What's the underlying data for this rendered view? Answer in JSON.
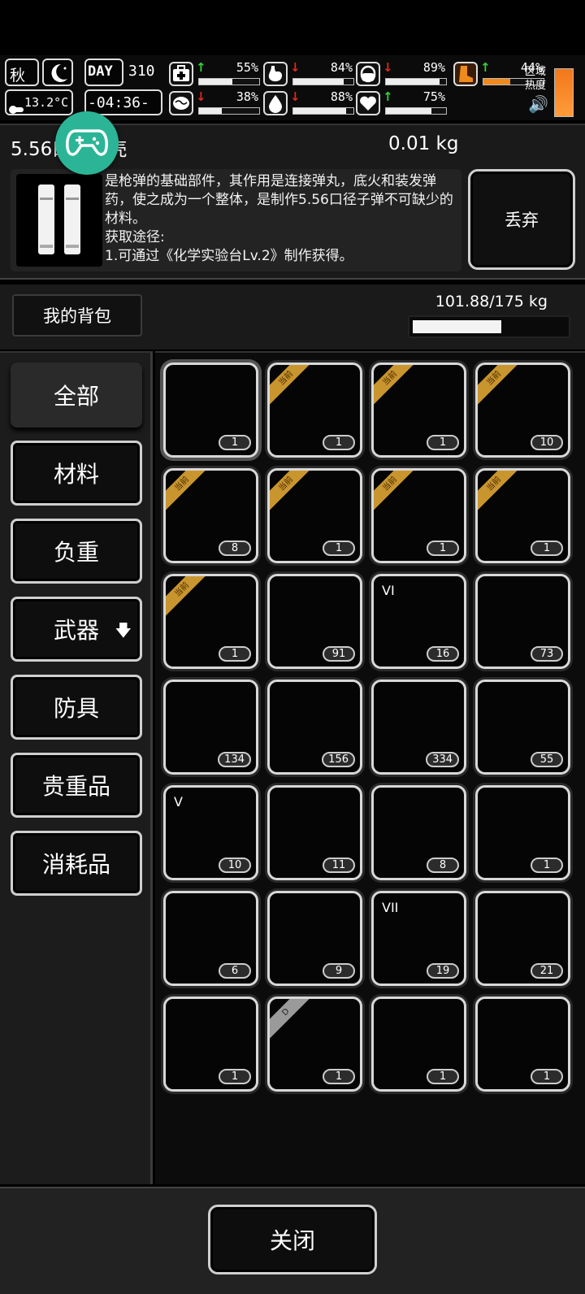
{
  "hud": {
    "season": "秋",
    "temperature": "13.2°C",
    "day_label": "DAY",
    "day_number": "310",
    "time": "-04:36-",
    "zone_label": "区域热度",
    "stats": [
      {
        "name": "health",
        "icon": "medkit-icon",
        "trend": "up",
        "arrow": "↑",
        "value": "55%",
        "level": 0.55
      },
      {
        "name": "hunger",
        "icon": "stomach-icon",
        "trend": "down",
        "arrow": "↓",
        "value": "84%",
        "level": 0.84
      },
      {
        "name": "medicine",
        "icon": "pill-icon",
        "trend": "down",
        "arrow": "↓",
        "value": "89%",
        "level": 0.89
      },
      {
        "name": "brain",
        "icon": "brain-icon",
        "trend": "down",
        "arrow": "↓",
        "value": "38%",
        "level": 0.38
      },
      {
        "name": "thirst",
        "icon": "water-drop-icon",
        "trend": "down",
        "arrow": "↓",
        "value": "88%",
        "level": 0.88
      },
      {
        "name": "mood",
        "icon": "heart-icon",
        "trend": "up",
        "arrow": "↑",
        "value": "75%",
        "level": 0.75
      },
      {
        "name": "stamina",
        "icon": "boot-icon",
        "trend": "up",
        "arrow": "↑",
        "value": "44%",
        "level": 0.44
      }
    ]
  },
  "detail": {
    "name": "5.56口径弹壳",
    "weight": "0.01 kg",
    "description": "是枪弹的基础部件，其作用是连接弹丸，底火和装发弹药，使之成为一个整体，是制作5.56口径子弹不可缺少的材料。",
    "source_label": "获取途径:",
    "source_1": "1.可通过《化学实验台Lv.2》制作获得。",
    "discard_label": "丢弃"
  },
  "backpack": {
    "title": "我的背包",
    "weight_text": "101.88/175 kg",
    "weight_fraction": 0.582
  },
  "categories": [
    {
      "label": "全部",
      "name": "category-all"
    },
    {
      "label": "材料",
      "name": "category-materials"
    },
    {
      "label": "负重",
      "name": "category-load"
    },
    {
      "label": "武器",
      "name": "category-weapons",
      "dl": "🡇"
    },
    {
      "label": "防具",
      "name": "category-armor"
    },
    {
      "label": "贵重品",
      "name": "category-valuables"
    },
    {
      "label": "消耗品",
      "name": "category-consumables"
    }
  ],
  "items": [
    {
      "icon": "bullet-casing",
      "count": "1",
      "tag": ""
    },
    {
      "icon": "exoskeleton",
      "count": "1",
      "tag": "当前"
    },
    {
      "icon": "armor-plate",
      "count": "1",
      "tag": "当前"
    },
    {
      "icon": "ammo-box",
      "count": "10",
      "tag": "当前"
    },
    {
      "icon": "canteen",
      "count": "8",
      "tag": "当前"
    },
    {
      "icon": "gas-mask",
      "count": "1",
      "tag": "当前"
    },
    {
      "icon": "chest-rig",
      "count": "1",
      "tag": "当前"
    },
    {
      "icon": "helmet",
      "count": "1",
      "tag": "当前"
    },
    {
      "icon": "spiked-club",
      "count": "1",
      "tag": "当前"
    },
    {
      "icon": "ore-rock",
      "count": "91",
      "tag": ""
    },
    {
      "icon": "test-tube-vi",
      "count": "16",
      "tag": ""
    },
    {
      "icon": "cloth-roll",
      "count": "73",
      "tag": ""
    },
    {
      "icon": "cloth-sheet",
      "count": "134",
      "tag": ""
    },
    {
      "icon": "leather-strip",
      "count": "156",
      "tag": ""
    },
    {
      "icon": "folded-cloth",
      "count": "334",
      "tag": ""
    },
    {
      "icon": "torn-shirt",
      "count": "55",
      "tag": ""
    },
    {
      "icon": "test-tube-v",
      "count": "10",
      "tag": ""
    },
    {
      "icon": "spool-orange",
      "count": "11",
      "tag": ""
    },
    {
      "icon": "yellow-cloth",
      "count": "8",
      "tag": ""
    },
    {
      "icon": "white-roll",
      "count": "1",
      "tag": ""
    },
    {
      "icon": "paper-roll",
      "count": "6",
      "tag": ""
    },
    {
      "icon": "thread-spool",
      "count": "9",
      "tag": ""
    },
    {
      "icon": "test-tube-vii",
      "count": "19",
      "tag": ""
    },
    {
      "icon": "yellow-crystal",
      "count": "21",
      "tag": ""
    },
    {
      "icon": "wet-rag",
      "count": "1",
      "tag": ""
    },
    {
      "icon": "red-katana",
      "count": "1",
      "tag": "D"
    },
    {
      "icon": "red-katana",
      "count": "1",
      "tag": ""
    },
    {
      "icon": "red-katana",
      "count": "1",
      "tag": ""
    }
  ],
  "tube_labels": {
    "vi": "VI",
    "v": "V",
    "vii": "VII"
  },
  "footer": {
    "close_label": "关闭"
  },
  "colors": {
    "tag": "#c9952e",
    "accent_green": "#2bb596",
    "up": "#34d23a",
    "down": "#e0281e",
    "katana": "#d1191b",
    "orange": "#f08a1c",
    "yellow": "#f5e03c"
  }
}
